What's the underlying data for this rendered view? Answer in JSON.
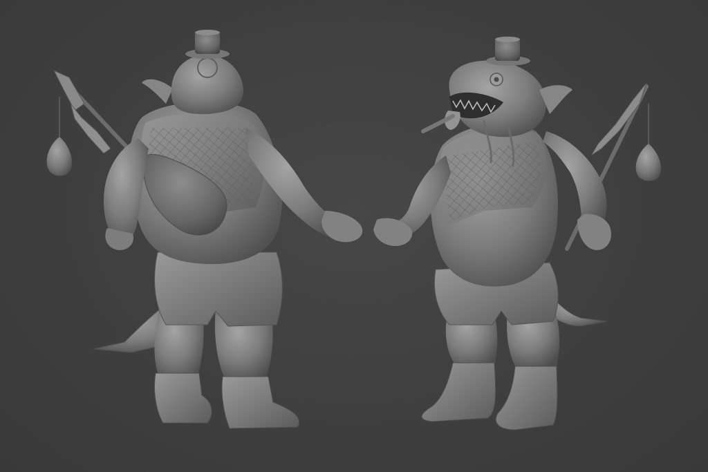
{
  "scene": {
    "background_color": "#3f3f3f",
    "material_color": "#8a8a8a",
    "views": [
      {
        "id": "back-view",
        "subject": "fish-creature-sculpt"
      },
      {
        "id": "front-view",
        "subject": "fish-creature-sculpt"
      }
    ]
  }
}
